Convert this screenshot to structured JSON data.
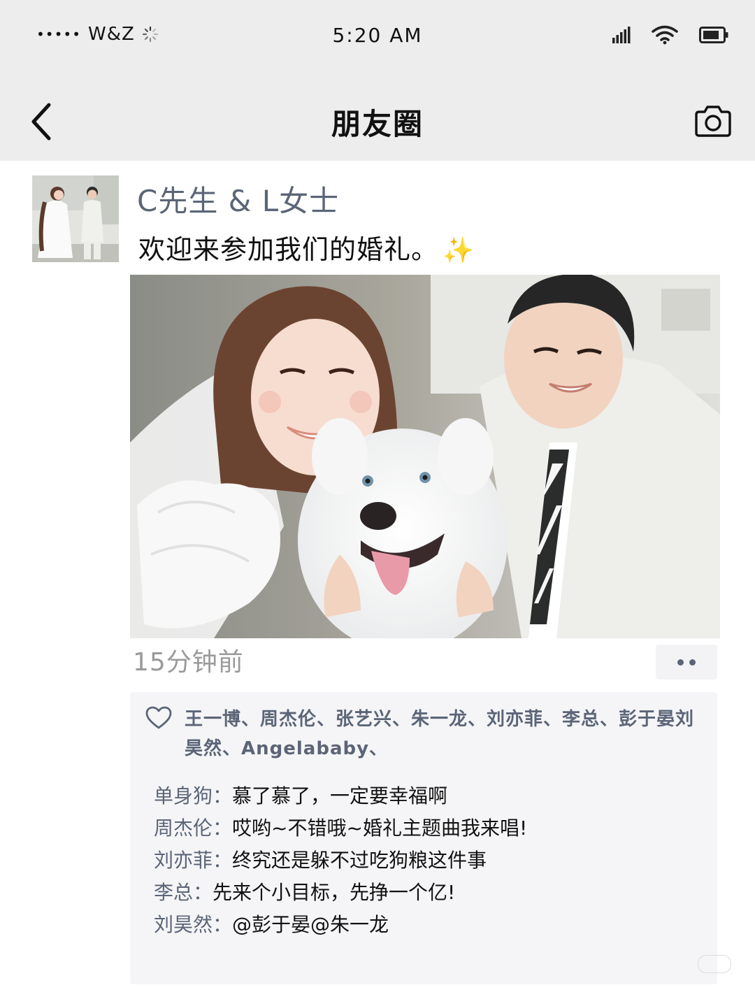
{
  "status_bar": {
    "signal_dots": "•••••",
    "carrier": "W&Z",
    "time": "5:20 AM"
  },
  "nav": {
    "title": "朋友圈"
  },
  "post": {
    "author": "C先生 & L女士",
    "text": "欢迎来参加我们的婚礼。",
    "emoji": "✨",
    "timestamp": "15分钟前"
  },
  "likes": {
    "names": "王一博、周杰伦、张艺兴、朱一龙、刘亦菲、李总、彭于晏刘昊然、Angelababy、"
  },
  "comments": [
    {
      "name": "单身狗",
      "sep": "：",
      "text": "慕了慕了，一定要幸福啊"
    },
    {
      "name": "周杰伦",
      "sep": "：",
      "text": "哎哟~不错哦~婚礼主题曲我来唱!"
    },
    {
      "name": "刘亦菲",
      "sep": "：",
      "text": "终究还是躲不过吃狗粮这件事"
    },
    {
      "name": "李总",
      "sep": "：",
      "text": "先来个小目标，先挣一个亿!"
    },
    {
      "name": "刘昊然",
      "sep": "：",
      "text": "@彭于晏@朱一龙"
    }
  ],
  "icons": {
    "back": "chevron-left-icon",
    "camera": "camera-icon",
    "like": "heart-icon",
    "more": "more-dots-icon",
    "cellular": "cellular-signal-icon",
    "wifi": "wifi-icon",
    "battery": "battery-icon",
    "loading": "loading-spinner-icon"
  },
  "colors": {
    "header_bg": "#ededed",
    "link_blue": "#5b6577",
    "comment_box_bg": "#f5f5f7",
    "timestamp_gray": "#9a9a9a"
  }
}
